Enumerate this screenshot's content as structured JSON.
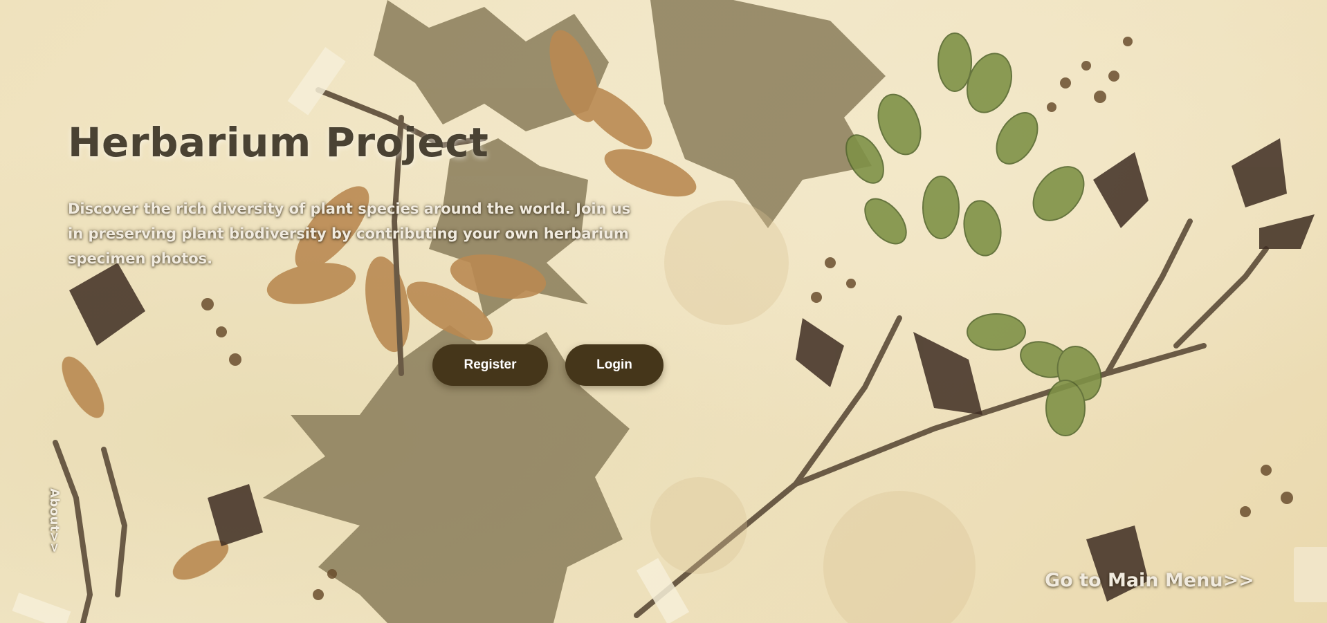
{
  "hero": {
    "title": "Herbarium Project",
    "subtitle": "Discover the rich diversity of plant species around the world. Join us in preserving plant biodiversity by contributing your own herbarium specimen photos."
  },
  "actions": {
    "register_label": "Register",
    "login_label": "Login"
  },
  "links": {
    "about": "About>>",
    "main_menu": "Go to Main Menu>>"
  },
  "colors": {
    "button_bg": "#45361a",
    "title": "#4a4233",
    "paper": "#efe3bf"
  }
}
